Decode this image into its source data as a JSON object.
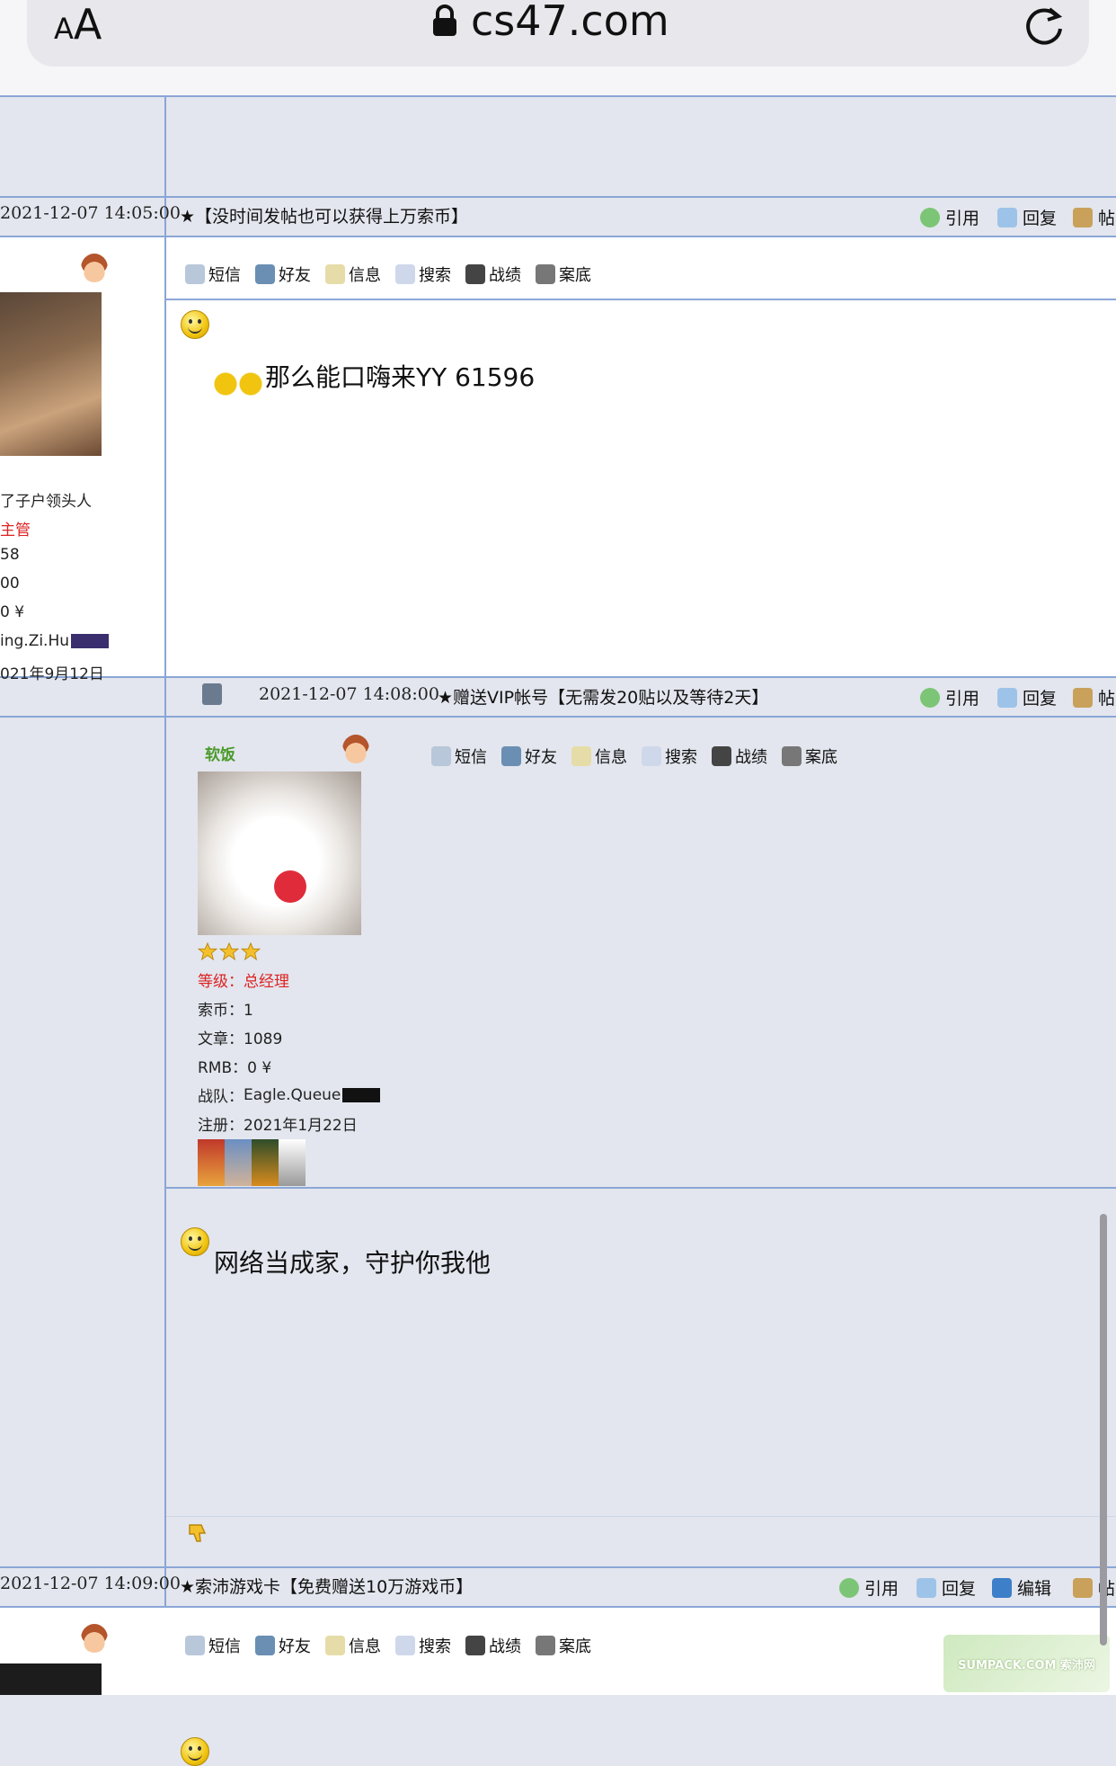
{
  "browser": {
    "text_size_label_small": "A",
    "text_size_label_large": "A",
    "url": "cs47.com"
  },
  "posts": [
    {
      "time": "2021-12-07 14:05:00",
      "title": "★【没时间发帖也可以获得上万索币】",
      "actions": [
        "引用",
        "回复",
        "帖"
      ],
      "content": "那么能口嗨来YY 61596",
      "user": {
        "title": "了子户领头人",
        "rank": "主管",
        "coins": "58",
        "articles": "00",
        "rmb": "0 ¥",
        "team": "ing.Zi.Hu",
        "registered": "021年9月12日"
      }
    },
    {
      "time": "2021-12-07 14:08:00",
      "title": "★赠送VIP帐号【无需发20贴以及等待2天】",
      "actions": [
        "引用",
        "回复",
        "帖"
      ],
      "content": "网络当成家，守护你我他",
      "user": {
        "name": "软饭",
        "rank_label": "等级：",
        "rank": "总经理",
        "coins_label": "索币：",
        "coins": "1",
        "articles_label": "文章：",
        "articles": "1089",
        "rmb_label": "RMB：",
        "rmb": "0 ¥",
        "team_label": "战队：",
        "team": "Eagle.Queue",
        "registered_label": "注册：",
        "registered": "2021年1月22日"
      }
    },
    {
      "time": "2021-12-07 14:09:00",
      "title": "★索沛游戏卡【免费赠送10万游戏币】",
      "actions": [
        "引用",
        "回复",
        "编辑",
        "帖"
      ]
    }
  ],
  "toolbar": [
    "短信",
    "好友",
    "信息",
    "搜索",
    "战绩",
    "案底"
  ],
  "watermark": "SUMPACK.COM 索沛网"
}
